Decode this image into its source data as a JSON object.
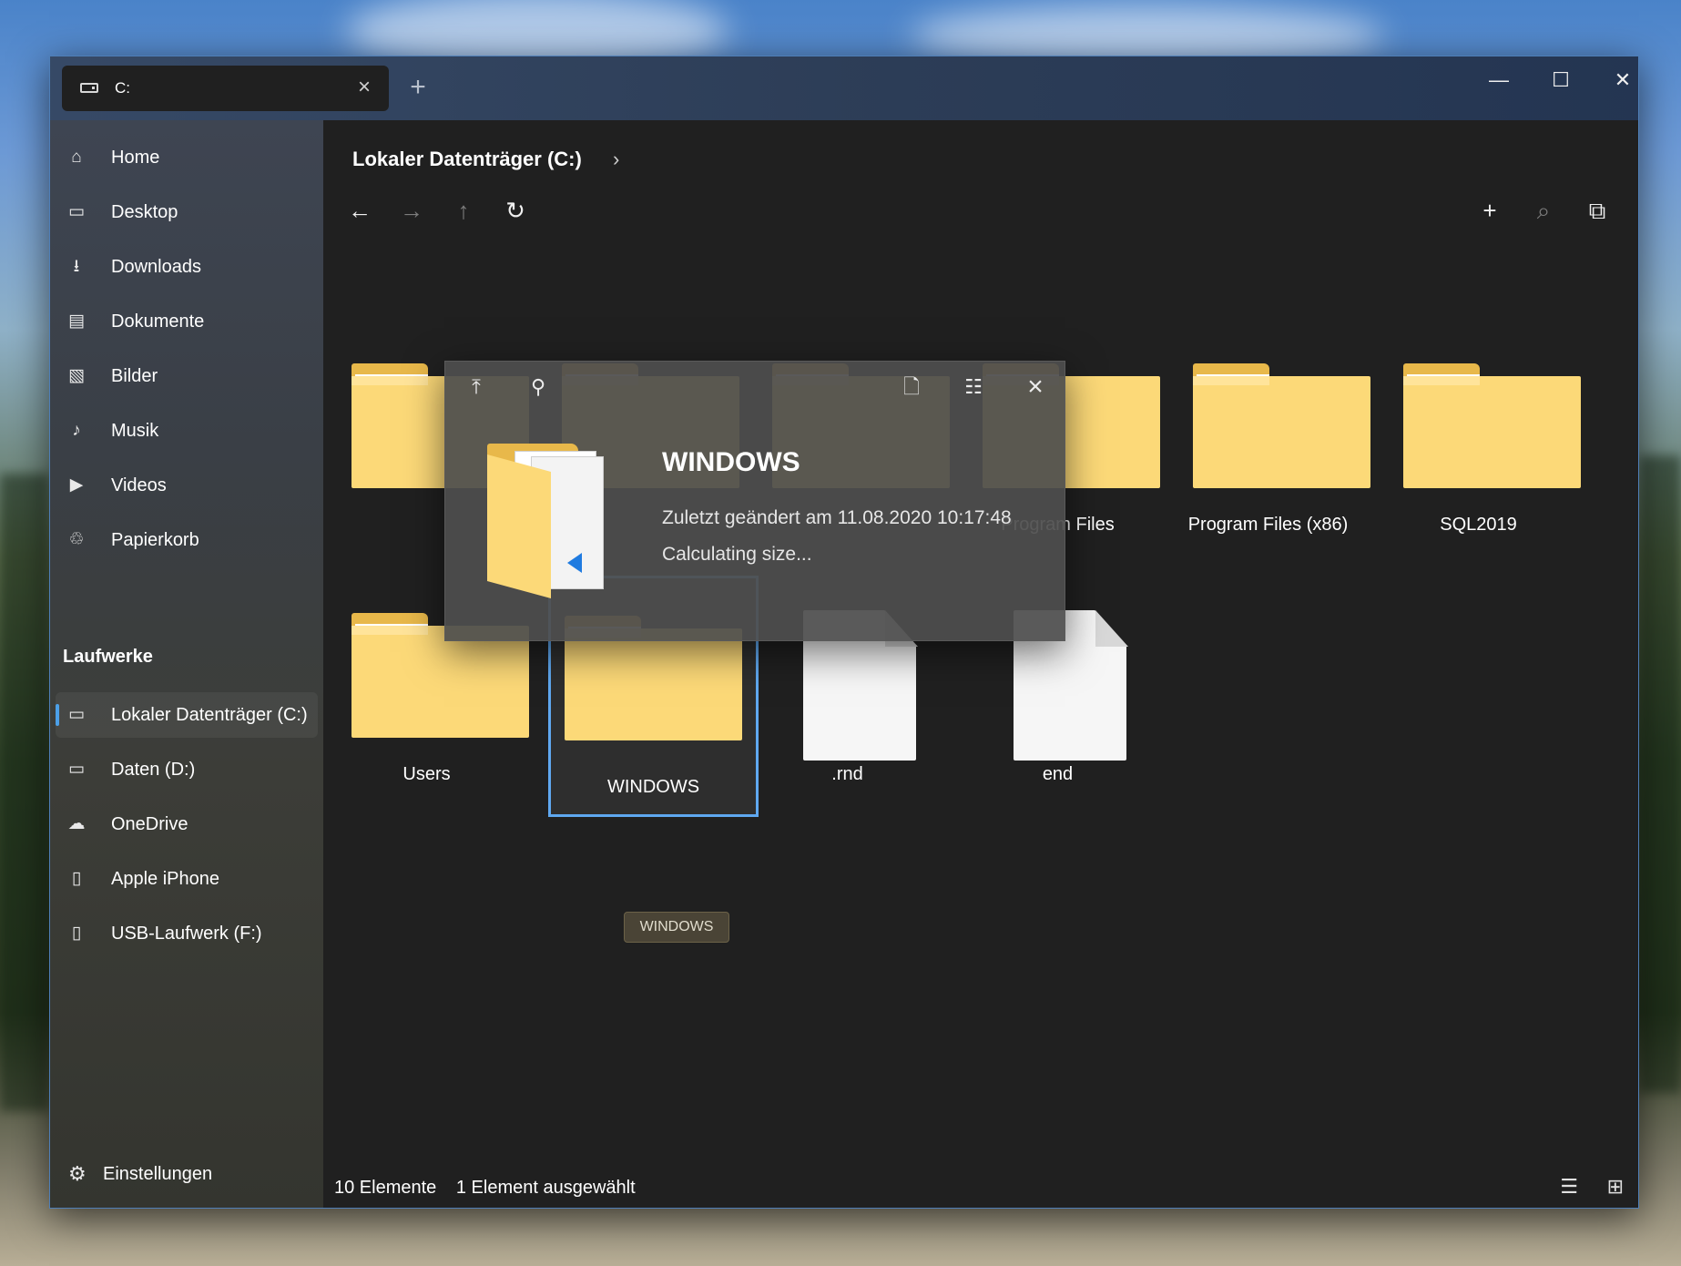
{
  "tab": {
    "label": "C:"
  },
  "window_controls": {
    "minimize": "—",
    "maximize": "☐",
    "close": "✕"
  },
  "sidebar": {
    "items": [
      {
        "label": "Home",
        "icon": "home-icon",
        "glyph": "⌂"
      },
      {
        "label": "Desktop",
        "icon": "desktop-icon",
        "glyph": "▭"
      },
      {
        "label": "Downloads",
        "icon": "download-icon",
        "glyph": "⭳"
      },
      {
        "label": "Dokumente",
        "icon": "document-icon",
        "glyph": "▤"
      },
      {
        "label": "Bilder",
        "icon": "image-icon",
        "glyph": "▧"
      },
      {
        "label": "Musik",
        "icon": "music-icon",
        "glyph": "♪"
      },
      {
        "label": "Videos",
        "icon": "video-icon",
        "glyph": "▶"
      },
      {
        "label": "Papierkorb",
        "icon": "recycle-bin-icon",
        "glyph": "♲"
      }
    ],
    "section_title": "Laufwerke",
    "drives": [
      {
        "label": "Lokaler Datenträger (C:)",
        "icon": "drive-icon",
        "glyph": "▭",
        "active": true
      },
      {
        "label": "Daten (D:)",
        "icon": "drive-icon",
        "glyph": "▭"
      },
      {
        "label": "OneDrive",
        "icon": "cloud-icon",
        "glyph": "☁"
      },
      {
        "label": "Apple iPhone",
        "icon": "phone-icon",
        "glyph": "▯"
      },
      {
        "label": "USB-Laufwerk (F:)",
        "icon": "usb-icon",
        "glyph": "▯"
      }
    ],
    "settings_label": "Einstellungen"
  },
  "main": {
    "breadcrumb": "Lokaler Datenträger (C:)",
    "breadcrumb_chevron": "›",
    "items": [
      {
        "label": "",
        "type": "folder"
      },
      {
        "label": "",
        "type": "folder"
      },
      {
        "label": "",
        "type": "folder"
      },
      {
        "label": "Program Files",
        "type": "folder"
      },
      {
        "label": "Program Files (x86)",
        "type": "folder"
      },
      {
        "label": "SQL2019",
        "type": "folder"
      },
      {
        "label": "Users",
        "type": "folder"
      },
      {
        "label": "WINDOWS",
        "type": "folder",
        "selected": true
      },
      {
        "label": ".rnd",
        "type": "file"
      },
      {
        "label": "end",
        "type": "file"
      }
    ],
    "tooltip": "WINDOWS"
  },
  "status": {
    "item_count": "10 Elemente",
    "selection": "1 Element ausgewählt"
  },
  "preview": {
    "title": "WINDOWS",
    "modified": "Zuletzt geändert am 11.08.2020 10:17:48",
    "size": "Calculating size..."
  },
  "colors": {
    "accent": "#4ca0e8",
    "folder": "#fcd978",
    "background": "#202020"
  }
}
